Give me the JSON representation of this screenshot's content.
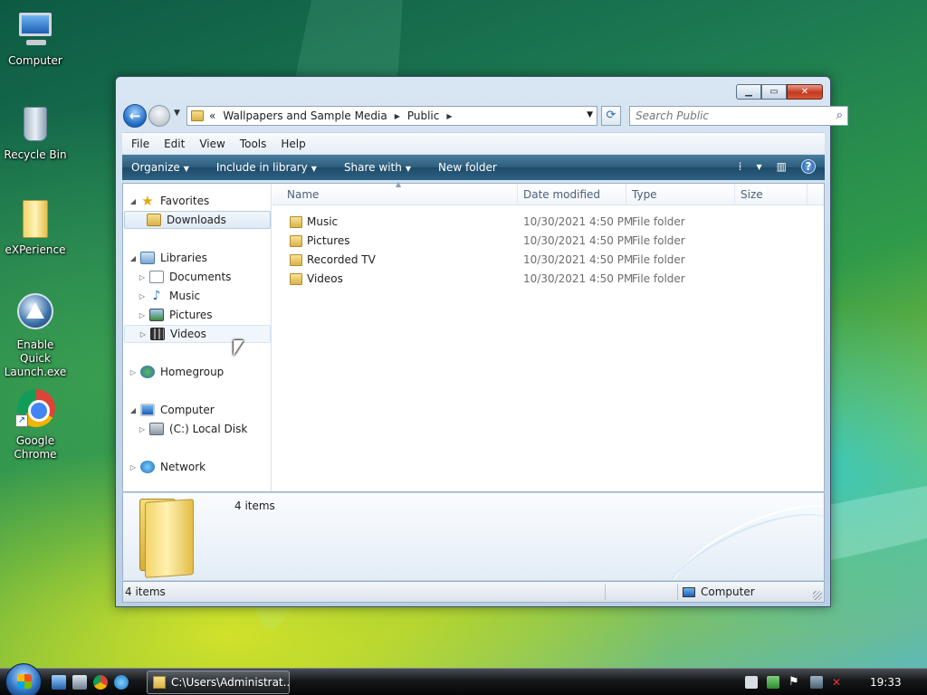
{
  "desktop": {
    "icons": [
      {
        "label": "Computer"
      },
      {
        "label": "Recycle Bin"
      },
      {
        "label": "eXPerience"
      },
      {
        "label_line1": "Enable Quick",
        "label_line2": "Launch.exe"
      },
      {
        "label_line1": "Google",
        "label_line2": "Chrome"
      }
    ]
  },
  "window": {
    "caption_buttons": {
      "minimize": "▁",
      "maximize": "▭",
      "close": "✕"
    },
    "address": {
      "overflow": "«",
      "segments": [
        "Wallpapers and Sample Media",
        "Public"
      ],
      "separator": "▶"
    },
    "search": {
      "placeholder": "Search Public"
    },
    "menu": [
      "File",
      "Edit",
      "View",
      "Tools",
      "Help"
    ],
    "toolbar": {
      "organize": "Organize",
      "include": "Include in library",
      "share": "Share with",
      "new_folder": "New folder",
      "help": "?"
    },
    "nav": {
      "favorites": "Favorites",
      "downloads": "Downloads",
      "libraries": "Libraries",
      "documents": "Documents",
      "music": "Music",
      "pictures": "Pictures",
      "videos": "Videos",
      "homegroup": "Homegroup",
      "computer": "Computer",
      "local_disk": "(C:) Local Disk",
      "network": "Network"
    },
    "columns": {
      "name": "Name",
      "date": "Date modified",
      "type": "Type",
      "size": "Size"
    },
    "files": [
      {
        "name": "Music",
        "date": "10/30/2021 4:50 PM",
        "type": "File folder"
      },
      {
        "name": "Pictures",
        "date": "10/30/2021 4:50 PM",
        "type": "File folder"
      },
      {
        "name": "Recorded TV",
        "date": "10/30/2021 4:50 PM",
        "type": "File folder"
      },
      {
        "name": "Videos",
        "date": "10/30/2021 4:50 PM",
        "type": "File folder"
      }
    ],
    "details": {
      "count": "4 items"
    },
    "status": {
      "left": "4 items",
      "right": "Computer"
    }
  },
  "taskbar": {
    "task": "C:\\Users\\Administrat...",
    "clock": "19:33"
  }
}
